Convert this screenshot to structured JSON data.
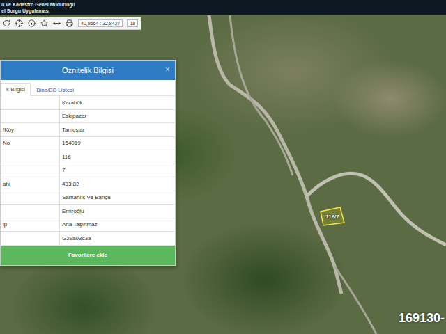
{
  "header": {
    "lines": [
      "u ve Kadastro Genel Müdürlüğü",
      "el Sorgu Uygulaması"
    ]
  },
  "toolbar": {
    "coordinates": "40,9564 : 32,8427",
    "zoom": "18"
  },
  "panel": {
    "title": "Öznitelik Bilgisi",
    "close": "×",
    "tabs": [
      {
        "label": "k Bilgisi",
        "selected": true
      },
      {
        "label": "Bina/BB Listesi",
        "selected": false
      }
    ],
    "rows": [
      {
        "label": "",
        "value": "Karabük"
      },
      {
        "label": "",
        "value": "Eskipazar"
      },
      {
        "label": "/Köy",
        "value": "Tamuşlar"
      },
      {
        "label": "No",
        "value": "154019"
      },
      {
        "label": "",
        "value": "116"
      },
      {
        "label": "",
        "value": "7"
      },
      {
        "label": "ahi",
        "value": "433,82"
      },
      {
        "label": "",
        "value": "Samanlık Ve Bahçe"
      },
      {
        "label": "",
        "value": "Emiroğlu"
      },
      {
        "label": "ip",
        "value": "Ana Taşınmaz"
      },
      {
        "label": "",
        "value": "G29a03c3a"
      }
    ],
    "button": "Favorilere ekle"
  },
  "map": {
    "parcel_label": "116/7",
    "watermark": "169130-"
  }
}
